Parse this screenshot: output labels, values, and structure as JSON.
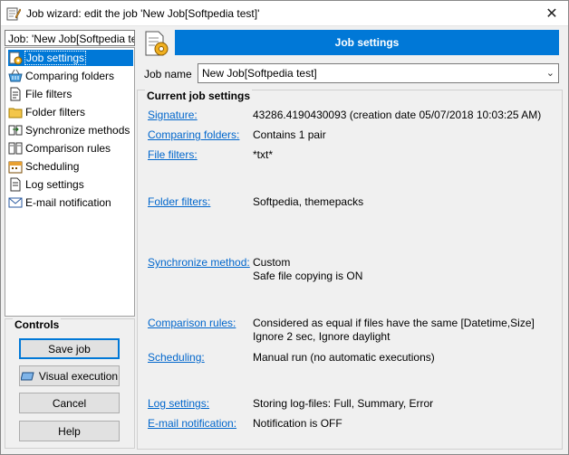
{
  "window": {
    "title": "Job wizard: edit the job 'New Job[Softpedia test]'",
    "close_glyph": "✕"
  },
  "job_selector": {
    "value": "Job: 'New Job[Softpedia test]'"
  },
  "nav": {
    "items": [
      {
        "label": "Job settings",
        "icon": "gear-doc-icon",
        "selected": true
      },
      {
        "label": "Comparing folders",
        "icon": "basket-icon"
      },
      {
        "label": "File filters",
        "icon": "doc-filter-icon"
      },
      {
        "label": "Folder filters",
        "icon": "folder-icon"
      },
      {
        "label": "Synchronize methods",
        "icon": "sync-icon"
      },
      {
        "label": "Comparison rules",
        "icon": "compare-icon"
      },
      {
        "label": "Scheduling",
        "icon": "calendar-icon"
      },
      {
        "label": "Log settings",
        "icon": "log-icon"
      },
      {
        "label": "E-mail notification",
        "icon": "email-icon"
      }
    ]
  },
  "controls": {
    "legend": "Controls",
    "save_label": "Save job",
    "visual_label": "Visual execution",
    "cancel_label": "Cancel",
    "help_label": "Help"
  },
  "header": {
    "title": "Job settings"
  },
  "job_name": {
    "label": "Job name",
    "value": "New Job[Softpedia test]"
  },
  "settings": {
    "legend": "Current job settings",
    "rows": [
      {
        "label": "Signature:",
        "lines": [
          "43286.4190430093 (creation date 05/07/2018 10:03:25 AM)"
        ]
      },
      {
        "label": "Comparing folders:",
        "lines": [
          "Contains 1 pair"
        ]
      },
      {
        "label": "File filters:",
        "lines": [
          "*txt*"
        ]
      },
      {
        "label": "Folder filters:",
        "lines": [
          "Softpedia, themepacks"
        ]
      },
      {
        "label": "Synchronize method:",
        "lines": [
          "Custom",
          "Safe file copying is ON"
        ]
      },
      {
        "label": "Comparison rules:",
        "lines": [
          "Considered as equal if files have the same [Datetime,Size]",
          "Ignore 2 sec, Ignore daylight"
        ]
      },
      {
        "label": "Scheduling:",
        "lines": [
          "Manual run (no automatic executions)"
        ]
      },
      {
        "label": "Log settings:",
        "lines": [
          "Storing log-files: Full, Summary, Error"
        ]
      },
      {
        "label": "E-mail notification:",
        "lines": [
          "Notification is OFF"
        ]
      }
    ]
  },
  "colors": {
    "accent": "#0078d7",
    "link": "#0066cc"
  }
}
